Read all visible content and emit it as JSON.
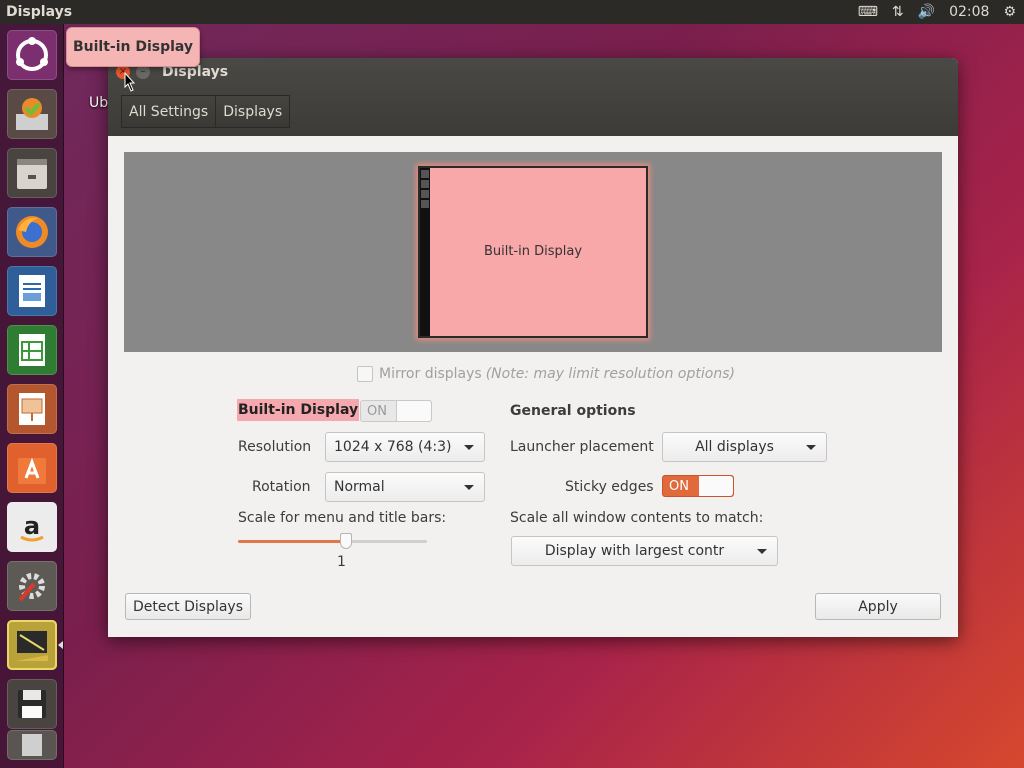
{
  "top_panel": {
    "app_title": "Displays",
    "time": "02:08",
    "indicators": [
      {
        "icon": "keyboard-icon",
        "glyph": "⌨"
      },
      {
        "icon": "network-icon",
        "glyph": "⇅"
      },
      {
        "icon": "volume-icon",
        "glyph": "🔊"
      }
    ],
    "system_icon": "⚙"
  },
  "launcher": {
    "items": [
      {
        "name": "dash-home"
      },
      {
        "name": "software-updater"
      },
      {
        "name": "files"
      },
      {
        "name": "firefox"
      },
      {
        "name": "libreoffice-writer"
      },
      {
        "name": "libreoffice-calc"
      },
      {
        "name": "libreoffice-impress"
      },
      {
        "name": "ubuntu-software"
      },
      {
        "name": "amazon"
      },
      {
        "name": "system-settings"
      },
      {
        "name": "displays"
      },
      {
        "name": "save"
      },
      {
        "name": "trash"
      }
    ]
  },
  "desktop": {
    "label_peek": "Ub"
  },
  "tooltip": {
    "text": "Built-in Display"
  },
  "window": {
    "title": "Displays",
    "close_glyph": "×",
    "min_glyph": "–",
    "nav": {
      "all_settings": "All Settings",
      "displays": "Displays"
    },
    "monitor": {
      "label": "Built-in Display"
    },
    "mirror": {
      "label": "Mirror displays",
      "note": "(Note: may limit resolution options)"
    },
    "display": {
      "name": "Built-in Display",
      "switch_label": "ON",
      "resolution_label": "Resolution",
      "resolution_value": "1024 x 768 (4:3)",
      "rotation_label": "Rotation",
      "rotation_value": "Normal",
      "scale_label": "Scale for menu and title bars:",
      "scale_value": "1",
      "scale_fraction": 0.57
    },
    "general": {
      "heading": "General options",
      "launcher_label": "Launcher placement",
      "launcher_value": "All displays",
      "sticky_label": "Sticky edges",
      "sticky_switch": "ON",
      "scale_all_label": "Scale all window contents to match:",
      "scale_all_value": "Display with largest contr"
    },
    "buttons": {
      "detect": "Detect Displays",
      "apply": "Apply"
    }
  },
  "colors": {
    "accent": "#e06a3c",
    "selection": "#f5a9ae"
  }
}
